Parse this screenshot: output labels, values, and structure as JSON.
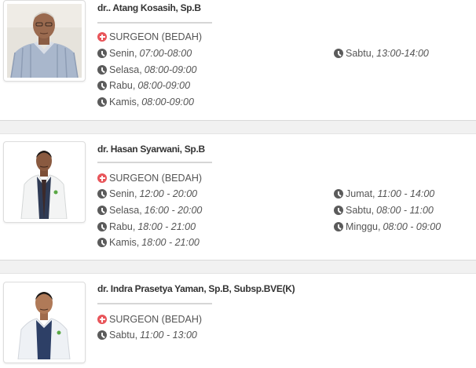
{
  "doctors": [
    {
      "name": "dr.. Atang Kosasih, Sp.B",
      "specialty": "SURGEON (BEDAH)",
      "schedule_left": [
        {
          "day": "Senin,",
          "time": "07:00-08:00"
        },
        {
          "day": "Selasa,",
          "time": "08:00-09:00"
        },
        {
          "day": "Rabu,",
          "time": "08:00-09:00"
        },
        {
          "day": "Kamis,",
          "time": "08:00-09:00"
        }
      ],
      "schedule_right": [
        {
          "day": "Sabtu,",
          "time": "13:00-14:00"
        }
      ]
    },
    {
      "name": "dr. Hasan Syarwani, Sp.B",
      "specialty": "SURGEON (BEDAH)",
      "schedule_left": [
        {
          "day": "Senin,",
          "time": "12:00 - 20:00"
        },
        {
          "day": "Selasa,",
          "time": "16:00 - 20:00"
        },
        {
          "day": "Rabu,",
          "time": "18:00 - 21:00"
        },
        {
          "day": "Kamis,",
          "time": "18:00 - 21:00"
        }
      ],
      "schedule_right": [
        {
          "day": "Jumat,",
          "time": "11:00 - 14:00"
        },
        {
          "day": "Sabtu,",
          "time": "08:00 - 11:00"
        },
        {
          "day": "Minggu,",
          "time": "08:00 - 09:00"
        }
      ]
    },
    {
      "name": "dr. Indra Prasetya Yaman, Sp.B, Subsp.BVE(K)",
      "specialty": "SURGEON (BEDAH)",
      "schedule_left": [
        {
          "day": "Sabtu,",
          "time": "11:00 - 13:00"
        }
      ],
      "schedule_right": []
    }
  ],
  "icons": {
    "specialty": "plus-circle-icon",
    "schedule": "clock-icon"
  },
  "colors": {
    "specialty_icon": "#e8555a",
    "clock_icon": "#5b5b5b",
    "separator": "#f1f1f1"
  }
}
